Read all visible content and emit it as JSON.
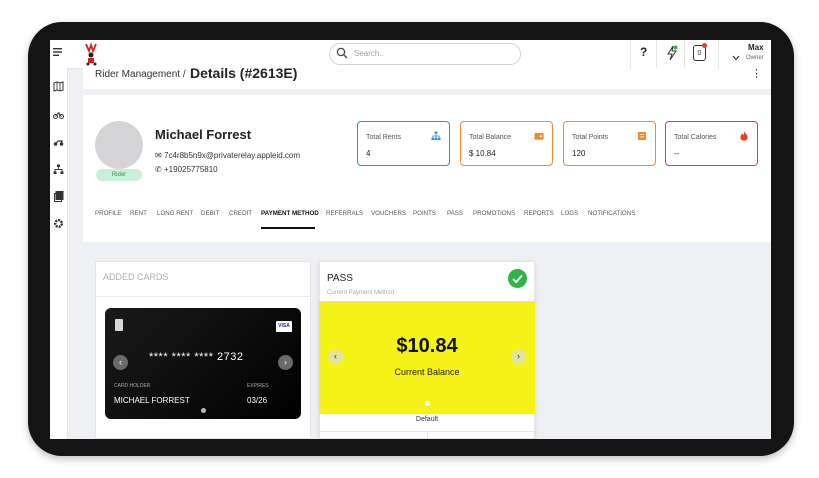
{
  "header": {
    "search_placeholder": "Search..",
    "help_label": "?",
    "notification_count": "0",
    "user_name": "Max",
    "user_role": "Owner"
  },
  "breadcrumb": {
    "parent": "Rider Management /",
    "current": "Details (#2613E)"
  },
  "profile": {
    "name": "Michael Forrest",
    "email": "7c4r8b5n9x@privaterelay.appleid.com",
    "phone": "+19025775810",
    "badge": "Rider"
  },
  "stats": [
    {
      "label": "Total Rents",
      "value": "4",
      "icon": "sitemap-icon",
      "color": "#2e8fd8"
    },
    {
      "label": "Total Balance",
      "value": "$ 10.84",
      "icon": "wallet-icon",
      "color": "#f08a2b"
    },
    {
      "label": "Total Points",
      "value": "120",
      "icon": "points-icon",
      "color": "#f08a2b"
    },
    {
      "label": "Total Calories",
      "value": "--",
      "icon": "flame-icon",
      "color": "#e0412b"
    }
  ],
  "tabs": [
    "PROFILE",
    "RENT",
    "LONG RENT",
    "DEBIT",
    "CREDIT",
    "PAYMENT METHOD",
    "REFERRALS",
    "VOUCHERS",
    "POINTS",
    "PASS",
    "PROMOTIONS",
    "REPORTS",
    "LOGS",
    "NOTIFICATIONS"
  ],
  "active_tab": "PAYMENT METHOD",
  "added_cards": {
    "title": "ADDED CARDS",
    "card": {
      "brand": "VISA",
      "number": "**** **** **** 2732",
      "holder_label": "CARD HOLDER",
      "holder": "MICHAEL FORREST",
      "expires_label": "EXPIRES",
      "expires": "03/26"
    }
  },
  "pass": {
    "title": "PASS",
    "subtitle": "Current Payment Method",
    "amount": "$10.84",
    "amount_label": "Current Balance",
    "default_label": "Default"
  }
}
